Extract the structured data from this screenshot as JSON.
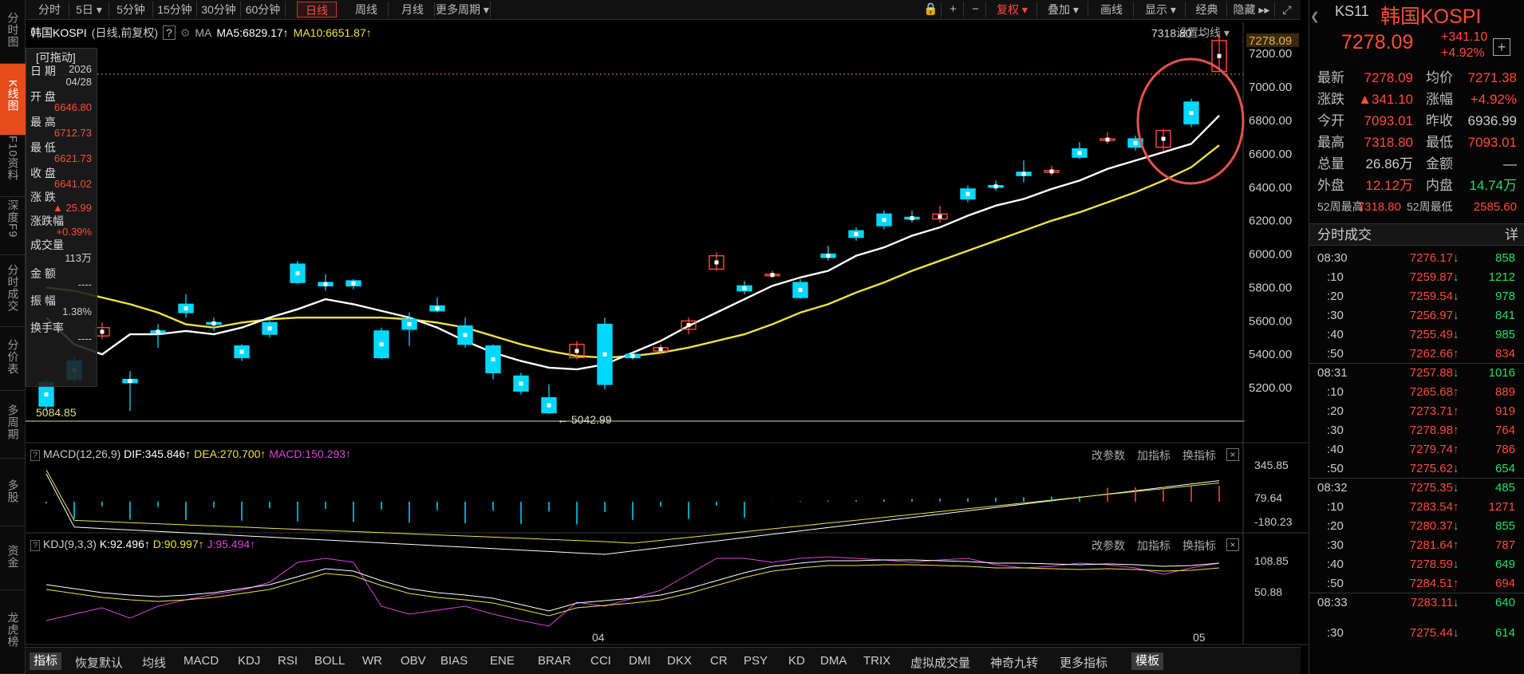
{
  "left_sidebar": [
    {
      "label": "分时图",
      "active": false
    },
    {
      "label": "K线图",
      "active": true
    },
    {
      "label": "F10资料",
      "active": false
    },
    {
      "label": "深度F9",
      "active": false
    },
    {
      "label": "分时成交",
      "active": false
    },
    {
      "label": "分价表",
      "active": false
    },
    {
      "label": "多周期",
      "active": false
    },
    {
      "label": "多股",
      "active": false
    },
    {
      "label": "资金",
      "active": false
    },
    {
      "label": "龙虎榜",
      "active": false
    }
  ],
  "period_tabs": [
    "分时",
    "5日 ▾",
    "5分钟",
    "15分钟",
    "30分钟",
    "60分钟",
    "日线",
    "周线",
    "月线",
    "更多周期 ▾"
  ],
  "active_period": "日线",
  "tools": [
    "复权 ▾",
    "叠加 ▾",
    "画线",
    "显示 ▾",
    "经典",
    "隐藏 ▸▸"
  ],
  "chart_header": {
    "name": "韩国KOSPI",
    "mode": "(日线,前复权)",
    "help": "?",
    "ma_label": "MA",
    "ma5": "MA5:6829.17↑",
    "ma10": "MA10:6651.87↑",
    "settings": "设置均线 ▾"
  },
  "info_box": {
    "draggable": "[可拖动]",
    "rows": [
      [
        "日 期",
        "2026"
      ],
      [
        "",
        "04/28"
      ],
      [
        "开 盘",
        "6646.80"
      ],
      [
        "最 高",
        "6712.73"
      ],
      [
        "最 低",
        "6621.73"
      ],
      [
        "收 盘",
        "6641.02"
      ],
      [
        "涨 跌",
        "▲ 25.99"
      ],
      [
        "涨跌幅",
        "+0.39%"
      ],
      [
        "成交量",
        "113万"
      ],
      [
        "金 额",
        "----"
      ],
      [
        "振 幅",
        "1.38%"
      ],
      [
        "换手率",
        "----"
      ]
    ]
  },
  "price_axis": [
    "7200.00",
    "7000.00",
    "6800.00",
    "6600.00",
    "6400.00",
    "6200.00",
    "6000.00",
    "5800.00",
    "5600.00",
    "5400.00",
    "5200.00"
  ],
  "current_price_tag": "7278.09",
  "high_marker": "7318.80 →",
  "low_marker": "← 5042.99",
  "low_left_label": "5084.85",
  "macd": {
    "label": "MACD(12,26,9)",
    "dif": "DIF:345.846↑",
    "dea": "DEA:270.700↑",
    "macd": "MACD:150.293↑",
    "axis": [
      "345.85",
      "79.64",
      "-180.23"
    ],
    "btns": [
      "改参数",
      "加指标",
      "换指标"
    ]
  },
  "kdj": {
    "label": "KDJ(9,3,3)",
    "k": "K:92.496↑",
    "d": "D:90.997↑",
    "j": "J:95.494↑",
    "axis": [
      "108.85",
      "50.88"
    ],
    "btns": [
      "改参数",
      "加指标",
      "换指标"
    ]
  },
  "date_axis": [
    "04",
    "05"
  ],
  "bottom_tabs": [
    "指标",
    "恢复默认",
    "均线",
    "MACD",
    "KDJ",
    "RSI",
    "BOLL",
    "WR",
    "OBV",
    "BIAS",
    "ENE",
    "BRAR",
    "CCI",
    "DMI",
    "DKX",
    "CR",
    "PSY",
    "KD",
    "DMA",
    "TRIX",
    "虚拟成交量",
    "神奇九转",
    "更多指标",
    "模板"
  ],
  "quote": {
    "code": "KS11",
    "name": "韩国KOSPI",
    "price": "7278.09",
    "change": "+341.10",
    "pct": "+4.92%",
    "rows": [
      [
        "最新",
        "7278.09",
        "均价",
        "7271.38"
      ],
      [
        "涨跌",
        "▲341.10",
        "涨幅",
        "+4.92%"
      ],
      [
        "今开",
        "7093.01",
        "昨收",
        "6936.99"
      ],
      [
        "最高",
        "7318.80",
        "最低",
        "7093.01"
      ],
      [
        "总量",
        "26.86万",
        "金额",
        "—"
      ],
      [
        "外盘",
        "12.12万",
        "内盘",
        "14.74万"
      ],
      [
        "52周最高",
        "7318.80",
        "52周最低",
        "2585.60"
      ]
    ]
  },
  "trades_title": "分时成交",
  "trades_icon": "详",
  "trades": [
    [
      "08:30",
      "7276.17",
      "↓",
      "858"
    ],
    [
      ":10",
      "7259.87",
      "↓",
      "1212"
    ],
    [
      ":20",
      "7259.54",
      "↓",
      "978"
    ],
    [
      ":30",
      "7256.97",
      "↓",
      "841"
    ],
    [
      ":40",
      "7255.49",
      "↓",
      "985"
    ],
    [
      ":50",
      "7262.66",
      "↑",
      "834"
    ],
    [
      "08:31",
      "7257.88",
      "↓",
      "1016"
    ],
    [
      ":10",
      "7265.68",
      "↑",
      "889"
    ],
    [
      ":20",
      "7273.71",
      "↑",
      "919"
    ],
    [
      ":30",
      "7278.98",
      "↑",
      "764"
    ],
    [
      ":40",
      "7279.74",
      "↑",
      "786"
    ],
    [
      ":50",
      "7275.62",
      "↓",
      "654"
    ],
    [
      "08:32",
      "7275.35",
      "↓",
      "485"
    ],
    [
      ":10",
      "7283.54",
      "↑",
      "1271"
    ],
    [
      ":20",
      "7280.37",
      "↓",
      "855"
    ],
    [
      ":30",
      "7281.64",
      "↑",
      "787"
    ],
    [
      ":40",
      "7278.59",
      "↓",
      "649"
    ],
    [
      ":50",
      "7284.51",
      "↑",
      "694"
    ],
    [
      "08:33",
      "7283.11",
      "↓",
      "640"
    ],
    [
      "",
      "",
      "",
      " "
    ],
    [
      ":30",
      "7275.44",
      "↓",
      "614"
    ]
  ],
  "colors": {
    "up": "#ff4b3a",
    "down": "#00d8ff",
    "ma5": "#ffffff",
    "ma10": "#f0e040",
    "j": "#e040e0"
  },
  "chart_data": {
    "type": "candlestick",
    "ylim": [
      5000,
      7330
    ],
    "candles": [
      [
        5230,
        5090,
        5250,
        5060
      ],
      [
        5360,
        5250,
        5390,
        5230
      ],
      [
        5510,
        5560,
        5590,
        5490
      ],
      [
        5250,
        5230,
        5300,
        5060
      ],
      [
        5540,
        5530,
        5580,
        5440
      ],
      [
        5700,
        5650,
        5760,
        5620
      ],
      [
        5590,
        5580,
        5620,
        5540
      ],
      [
        5450,
        5380,
        5460,
        5360
      ],
      [
        5590,
        5520,
        5600,
        5500
      ],
      [
        5940,
        5830,
        5960,
        5820
      ],
      [
        5830,
        5810,
        5880,
        5780
      ],
      [
        5840,
        5810,
        5850,
        5790
      ],
      [
        5540,
        5380,
        5560,
        5370
      ],
      [
        5610,
        5550,
        5650,
        5450
      ],
      [
        5690,
        5660,
        5740,
        5650
      ],
      [
        5570,
        5460,
        5620,
        5440
      ],
      [
        5450,
        5290,
        5460,
        5250
      ],
      [
        5270,
        5180,
        5290,
        5160
      ],
      [
        5140,
        5050,
        5220,
        5042.99
      ],
      [
        5380,
        5460,
        5480,
        5370
      ],
      [
        5580,
        5220,
        5620,
        5190
      ],
      [
        5400,
        5380,
        5410,
        5370
      ],
      [
        5420,
        5440,
        5460,
        5400
      ],
      [
        5550,
        5600,
        5620,
        5520
      ],
      [
        5910,
        5990,
        6010,
        5900
      ],
      [
        5810,
        5780,
        5840,
        5760
      ],
      [
        5880,
        5880,
        5900,
        5860
      ],
      [
        5830,
        5740,
        5850,
        5730
      ],
      [
        6000,
        5980,
        6050,
        5960
      ],
      [
        6140,
        6100,
        6160,
        6080
      ],
      [
        6240,
        6170,
        6260,
        6150
      ],
      [
        6220,
        6210,
        6260,
        6190
      ],
      [
        6210,
        6240,
        6290,
        6190
      ],
      [
        6390,
        6330,
        6410,
        6310
      ],
      [
        6410,
        6400,
        6440,
        6380
      ],
      [
        6490,
        6470,
        6560,
        6430
      ],
      [
        6490,
        6500,
        6530,
        6470
      ],
      [
        6630,
        6580,
        6670,
        6570
      ],
      [
        6690,
        6690,
        6730,
        6660
      ],
      [
        6690,
        6640,
        6710,
        6620
      ],
      [
        6640,
        6740,
        6750,
        6620
      ],
      [
        6910,
        6780,
        6930,
        6760
      ],
      [
        7093.01,
        7278.09,
        7318.8,
        7093.01
      ]
    ],
    "ma5": [
      5620,
      5460,
      5400,
      5520,
      5520,
      5540,
      5520,
      5560,
      5620,
      5670,
      5730,
      5700,
      5660,
      5620,
      5560,
      5480,
      5410,
      5360,
      5320,
      5310,
      5340,
      5410,
      5480,
      5570,
      5650,
      5730,
      5810,
      5860,
      5900,
      5990,
      6040,
      6110,
      6160,
      6230,
      6290,
      6330,
      6390,
      6440,
      6510,
      6560,
      6610,
      6660,
      6829.17
    ],
    "ma10": [
      5800,
      5780,
      5740,
      5700,
      5650,
      5580,
      5560,
      5590,
      5610,
      5620,
      5620,
      5620,
      5620,
      5610,
      5590,
      5560,
      5510,
      5460,
      5420,
      5390,
      5380,
      5390,
      5410,
      5440,
      5480,
      5520,
      5580,
      5650,
      5700,
      5770,
      5830,
      5900,
      5960,
      6020,
      6080,
      6140,
      6200,
      6250,
      6310,
      6370,
      6440,
      6520,
      6651.87
    ]
  }
}
